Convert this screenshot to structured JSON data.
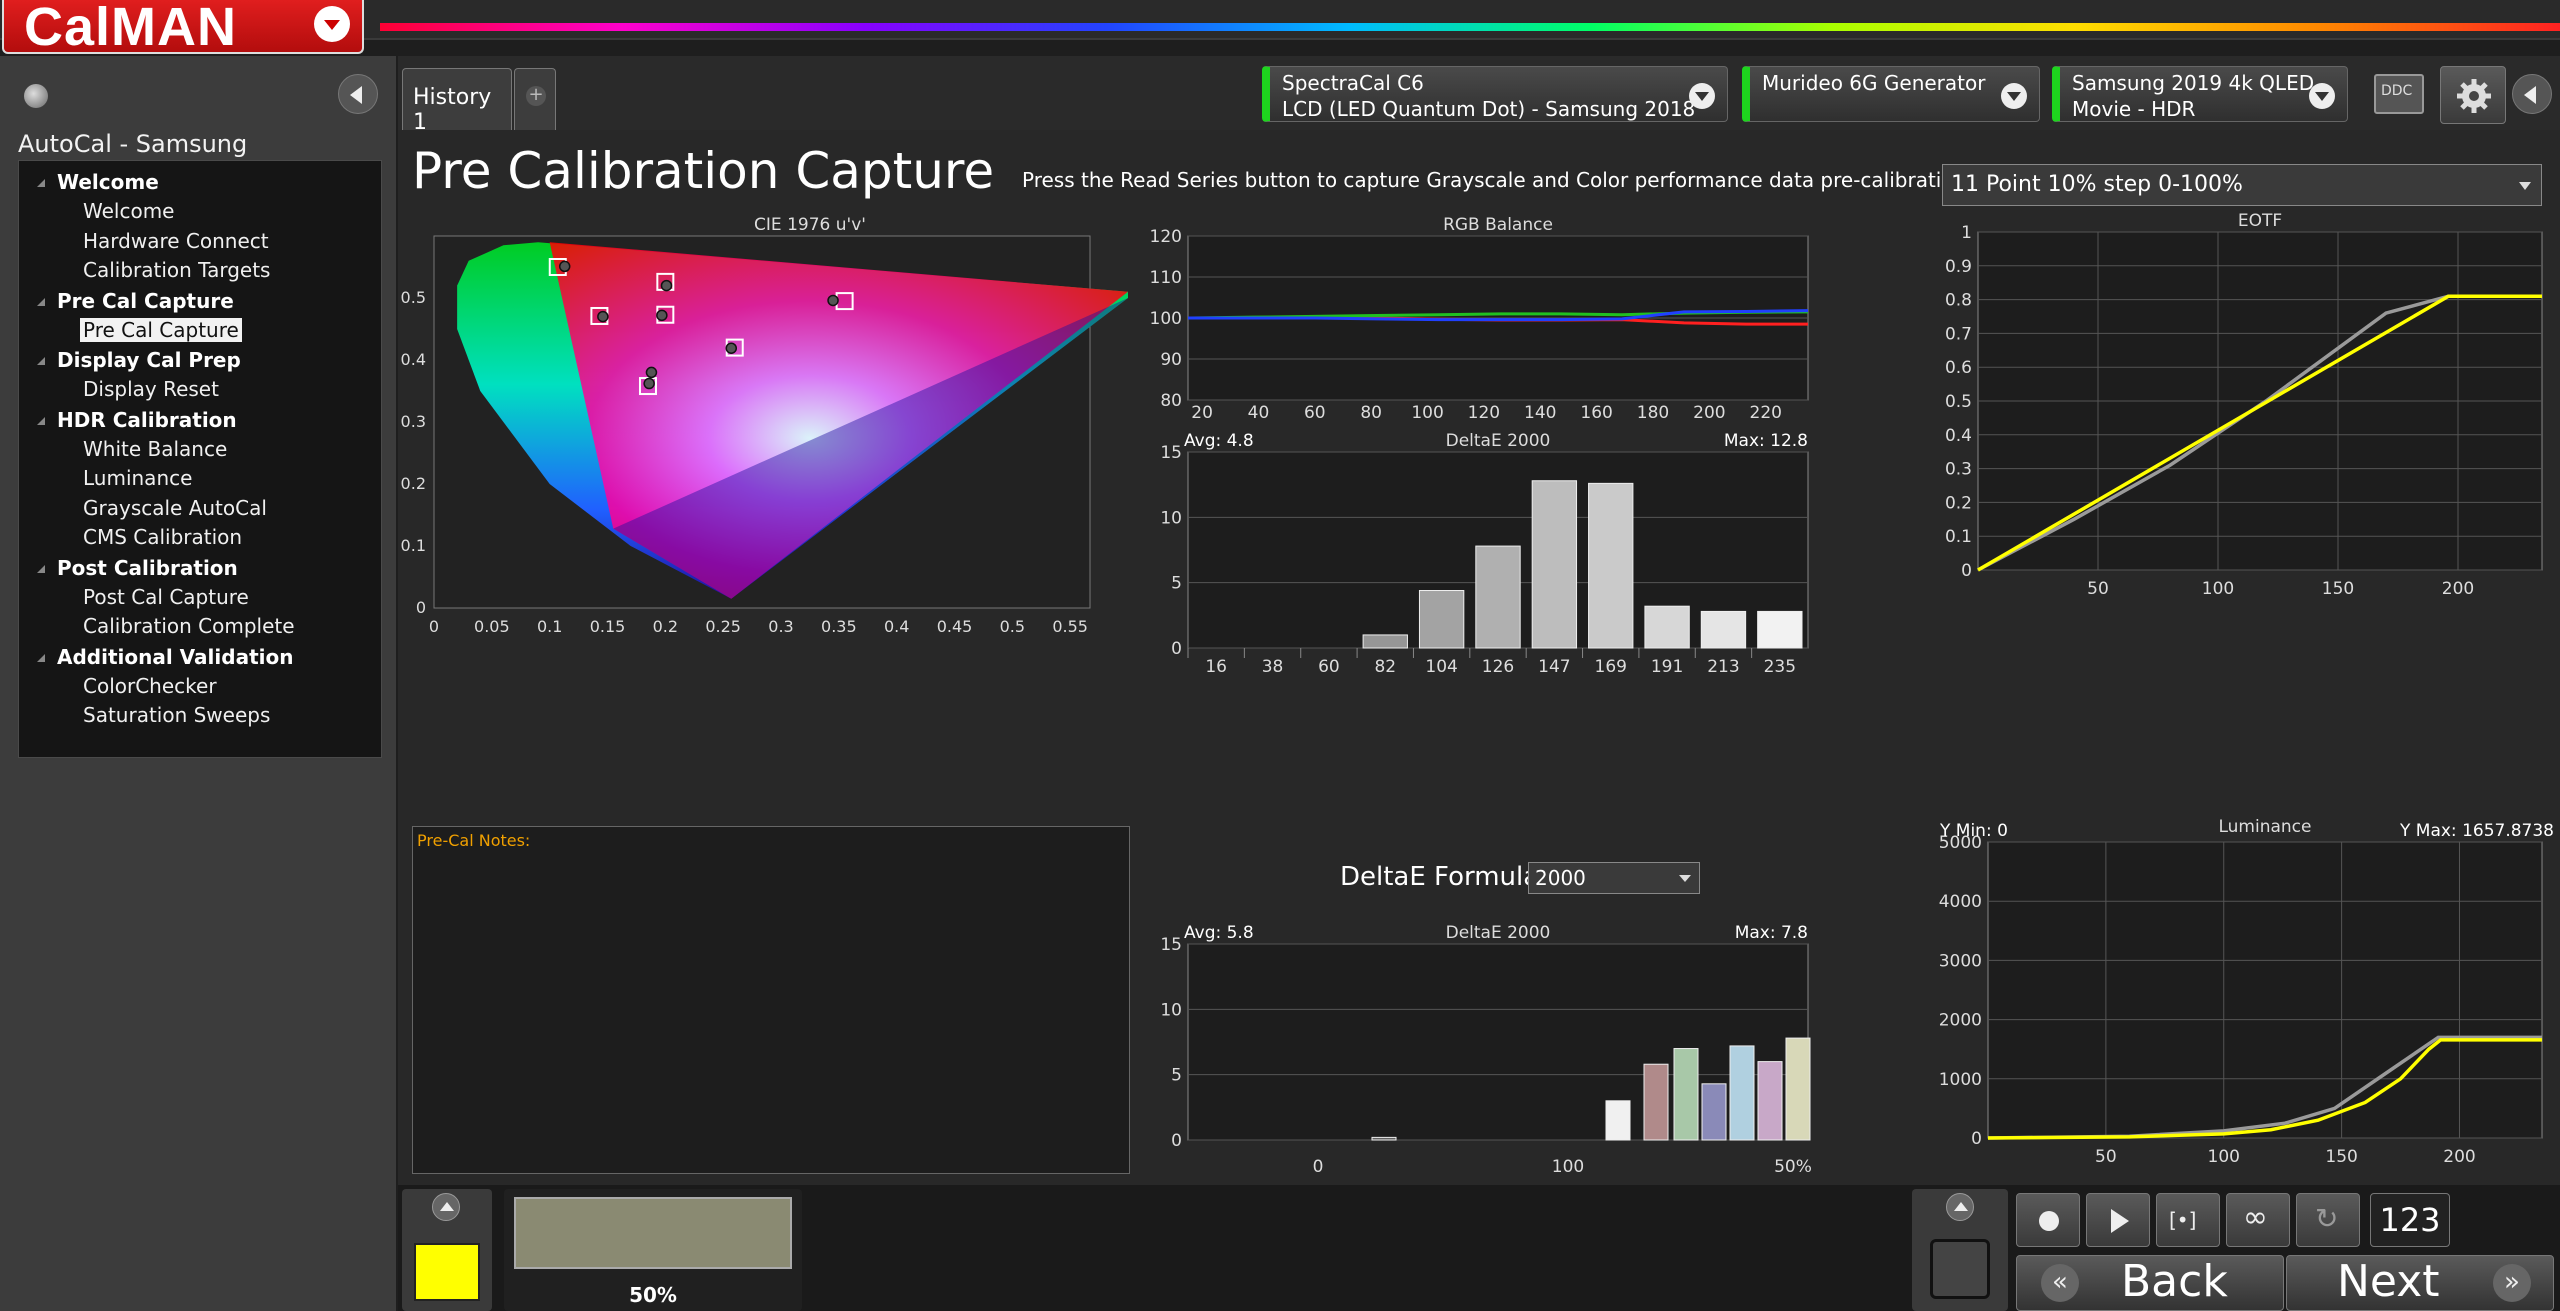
{
  "app": {
    "logo": "CalMAN"
  },
  "sidebar": {
    "project": "AutoCal - Samsung",
    "sections": [
      {
        "label": "Welcome",
        "items": [
          "Welcome",
          "Hardware Connect",
          "Calibration Targets"
        ]
      },
      {
        "label": "Pre Cal Capture",
        "items": [
          "Pre Cal Capture"
        ]
      },
      {
        "label": "Display Cal Prep",
        "items": [
          "Display Reset"
        ]
      },
      {
        "label": "HDR Calibration",
        "items": [
          "White Balance",
          "Luminance",
          "Grayscale AutoCal",
          "CMS Calibration"
        ]
      },
      {
        "label": "Post Calibration",
        "items": [
          "Post Cal Capture",
          "Calibration Complete"
        ]
      },
      {
        "label": "Additional Validation",
        "items": [
          "ColorChecker",
          "Saturation Sweeps"
        ]
      }
    ],
    "selected": "Pre Cal Capture"
  },
  "tabs": {
    "history": "History 1",
    "add": "+"
  },
  "devices": {
    "meter": {
      "line1": "SpectraCal C6",
      "line2": "LCD (LED Quantum Dot) - Samsung 2018"
    },
    "generator": {
      "line1": "Murideo 6G Generator",
      "line2": ""
    },
    "display": {
      "line1": "Samsung 2019 4k QLED",
      "line2": "Movie - HDR"
    },
    "ddc": "DDC"
  },
  "page": {
    "title": "Pre Calibration Capture",
    "instruction": "Press the Read Series button to capture Grayscale and Color performance data pre-calibration.",
    "series_select": "11 Point 10% step 0-100%",
    "notes_label": "Pre-Cal Notes:",
    "deltae_formula_label": "DeltaE Formula",
    "deltae_formula_value": "2000"
  },
  "colors": {
    "red": "#ff2020",
    "green": "#20c020",
    "blue": "#2040ff",
    "yellow": "#ffff00",
    "gray": "#9a9a9a",
    "accent": "#f0a000"
  },
  "chart_data": [
    {
      "id": "cie",
      "type": "scatter",
      "title": "CIE 1976 u'v'",
      "xlim": [
        0,
        0.6
      ],
      "ylim": [
        0,
        0.6
      ],
      "xticks": [
        0,
        0.05,
        0.1,
        0.15,
        0.2,
        0.25,
        0.3,
        0.35,
        0.4,
        0.45,
        0.5,
        0.55
      ],
      "yticks": [
        0,
        0.1,
        0.2,
        0.3,
        0.4,
        0.5
      ],
      "targets": [
        [
          0.107,
          0.55
        ],
        [
          0.143,
          0.471
        ],
        [
          0.2,
          0.526
        ],
        [
          0.2,
          0.473
        ],
        [
          0.26,
          0.42
        ],
        [
          0.355,
          0.495
        ],
        [
          0.185,
          0.358
        ]
      ],
      "measured": [
        [
          0.113,
          0.551
        ],
        [
          0.146,
          0.47
        ],
        [
          0.201,
          0.52
        ],
        [
          0.197,
          0.472
        ],
        [
          0.257,
          0.419
        ],
        [
          0.345,
          0.496
        ],
        [
          0.186,
          0.362
        ],
        [
          0.188,
          0.38
        ]
      ]
    },
    {
      "id": "rgb",
      "type": "line",
      "title": "RGB Balance",
      "x": [
        0,
        16,
        38,
        60,
        82,
        104,
        126,
        147,
        169,
        191,
        213,
        235
      ],
      "xticks": [
        20,
        40,
        60,
        80,
        100,
        120,
        140,
        160,
        180,
        200,
        220
      ],
      "ylim": [
        80,
        120
      ],
      "yticks": [
        80,
        90,
        100,
        110,
        120
      ],
      "xlim": [
        15,
        235
      ],
      "series": [
        {
          "color": "#ff2020",
          "values": [
            100,
            100,
            100,
            100,
            100,
            99.7,
            99.5,
            99.5,
            99.6,
            98.8,
            98.5,
            98.5
          ]
        },
        {
          "color": "#20c020",
          "values": [
            100,
            100,
            100.2,
            100.4,
            100.6,
            100.8,
            101,
            101,
            100.8,
            101.2,
            101.4,
            101.5
          ]
        },
        {
          "color": "#2040ff",
          "values": [
            100,
            100,
            100,
            100,
            99.8,
            99.6,
            99.6,
            99.6,
            99.8,
            101.5,
            101.6,
            101.8
          ]
        }
      ]
    },
    {
      "id": "de1",
      "type": "bar",
      "title": "DeltaE 2000",
      "avg_label": "Avg: 4.8",
      "max_label": "Max: 12.8",
      "categories": [
        "16",
        "38",
        "60",
        "82",
        "104",
        "126",
        "147",
        "169",
        "191",
        "213",
        "235"
      ],
      "values": [
        0,
        0,
        0,
        1,
        4.4,
        7.8,
        12.8,
        12.6,
        3.2,
        2.8,
        2.8
      ],
      "ylim": [
        0,
        15
      ],
      "yticks": [
        0,
        5,
        10,
        15
      ]
    },
    {
      "id": "de2",
      "type": "bar",
      "title": "DeltaE 2000",
      "avg_label": "Avg: 5.8",
      "max_label": "Max: 7.8",
      "xticks": [
        "0",
        "100",
        "50%"
      ],
      "values": [
        0.2,
        3.0,
        5.8,
        7.0,
        4.3,
        7.2,
        6.0,
        7.8
      ],
      "colors": [
        "#606060",
        "#f0f0f0",
        "#b08a8a",
        "#a8c8a8",
        "#8a8ab8",
        "#b0d0e0",
        "#c8a8c8",
        "#d8d8b8"
      ],
      "ylim": [
        0,
        15
      ],
      "yticks": [
        0,
        5,
        10,
        15
      ]
    },
    {
      "id": "eotf",
      "type": "line",
      "title": "EOTF",
      "xlim": [
        0,
        235
      ],
      "ylim": [
        0,
        1
      ],
      "xticks": [
        50,
        100,
        150,
        200
      ],
      "yticks": [
        0,
        0.1,
        0.2,
        0.3,
        0.4,
        0.5,
        0.6,
        0.7,
        0.8,
        0.9,
        1
      ],
      "series": [
        {
          "color": "#ffff00",
          "x": [
            0,
            196,
            235
          ],
          "values": [
            0,
            0.81,
            0.81
          ]
        },
        {
          "color": "#9a9a9a",
          "x": [
            0,
            40,
            80,
            120,
            170,
            196,
            235
          ],
          "values": [
            0,
            0.15,
            0.31,
            0.5,
            0.76,
            0.81,
            0.81
          ]
        }
      ]
    },
    {
      "id": "lum",
      "type": "line",
      "title": "Luminance",
      "ymin_label": "Y Min: 0",
      "ymax_label": "Y Max: 1657.8738",
      "xlim": [
        0,
        235
      ],
      "ylim": [
        0,
        5000
      ],
      "xticks": [
        50,
        100,
        150,
        200
      ],
      "yticks": [
        0,
        1000,
        2000,
        3000,
        4000,
        5000
      ],
      "series": [
        {
          "color": "#ffff00",
          "x": [
            0,
            60,
            100,
            120,
            140,
            160,
            175,
            187,
            192,
            235
          ],
          "values": [
            0,
            20,
            70,
            140,
            300,
            600,
            1000,
            1500,
            1658,
            1658
          ]
        },
        {
          "color": "#9a9a9a",
          "x": [
            0,
            60,
            100,
            126,
            147,
            169,
            191,
            235
          ],
          "values": [
            0,
            30,
            120,
            250,
            500,
            1100,
            1700,
            1700
          ]
        }
      ]
    }
  ],
  "bottom": {
    "patch_label": "50%",
    "patch_color": "#8a8a72",
    "swatch_color": "#ffff00",
    "counter": "123",
    "back": "Back",
    "next": "Next"
  }
}
